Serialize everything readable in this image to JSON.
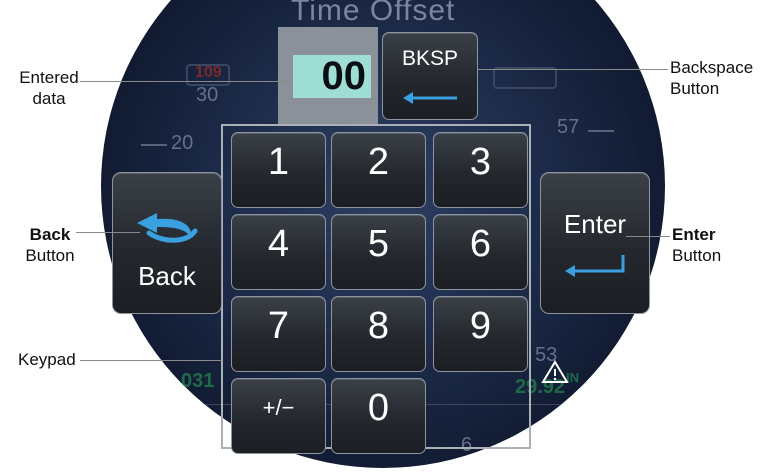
{
  "entry": {
    "value": "00"
  },
  "keypad": {
    "keys": [
      "1",
      "2",
      "3",
      "4",
      "5",
      "6",
      "7",
      "8",
      "9",
      "+/−",
      "0"
    ]
  },
  "buttons": {
    "backspace": "BKSP",
    "back": "Back",
    "enter": "Enter"
  },
  "background": {
    "title_fragment": "Time Offset",
    "values": [
      "109",
      "30",
      "20",
      "57",
      "53",
      "031",
      "29.92",
      "IN",
      "6"
    ]
  },
  "annotations": {
    "entered_data": [
      "Entered",
      "data"
    ],
    "backspace_button": [
      "Backspace",
      "Button"
    ],
    "back_button": [
      "Back",
      "Button"
    ],
    "enter_button": [
      "Enter",
      "Button"
    ],
    "keypad": "Keypad"
  },
  "colors": {
    "entry_fill": "#9fded5",
    "button_face": "#24282e",
    "display_bg": "#1c2a48",
    "accent_blue": "#3aa0e0"
  },
  "icons": [
    "back-arrow-icon",
    "enter-return-icon",
    "backspace-arrow-icon",
    "warning-icon"
  ]
}
